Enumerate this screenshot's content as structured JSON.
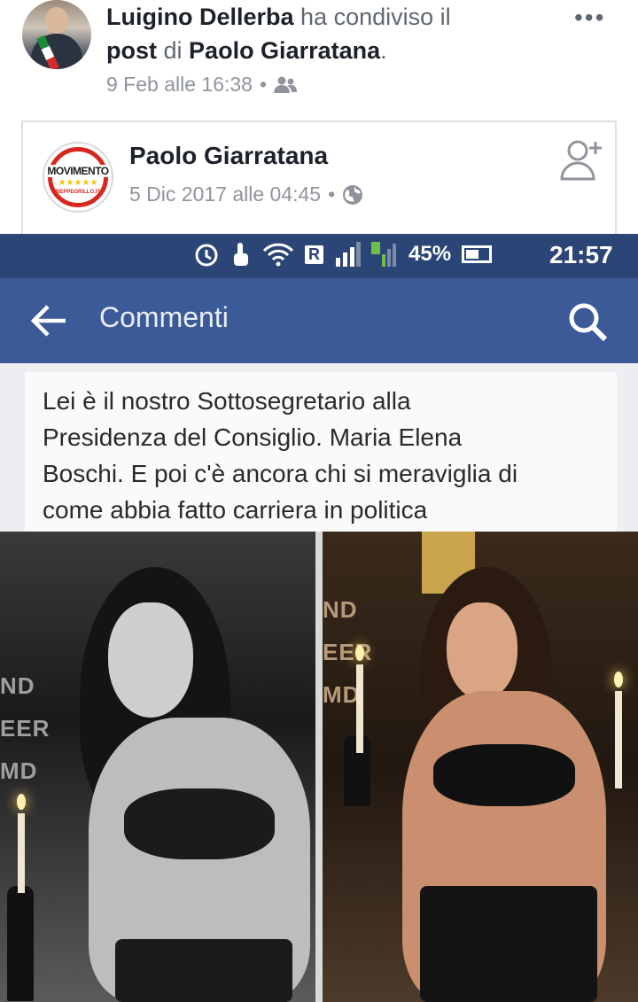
{
  "share": {
    "sharer_name": "Luigino Dellerba",
    "shared_phrase": "ha condiviso il",
    "post_word": "post",
    "of_word": "di",
    "author_name": "Paolo Giarratana",
    "period": ".",
    "timestamp": "9 Feb alle 16:38",
    "separator": "•",
    "audience_icon": "friends-icon",
    "more_label": "•••"
  },
  "original_post": {
    "page_name": "Paolo Giarratana",
    "timestamp": "5 Dic 2017 alle 04:45",
    "separator": "•",
    "audience_icon": "globe-icon",
    "logo": {
      "word": "MOVIMENTO",
      "stars": "★★★★★",
      "subtitle": "BEPPEGRILLO.IT",
      "ring_color": "#d6281f",
      "star_color": "#f3c10f"
    },
    "add_friend_icon": "add-friend-icon"
  },
  "screenshot": {
    "status_bar": {
      "r_badge": "R",
      "signal_1": "4",
      "signal_2": "2",
      "battery": "45%",
      "time": "21:57"
    },
    "app_bar": {
      "title": "Commenti",
      "back_icon": "back-arrow-icon",
      "search_icon": "search-icon",
      "color": "#3c5a98"
    },
    "comment": {
      "line1": "Lei è il nostro Sottosegretario alla",
      "line2": "Presidenza del Consiglio. Maria Elena",
      "line3": "Boschi. E poi c'è ancora chi si meraviglia di",
      "line4": "come abbia fatto carriera in politica"
    },
    "photos": {
      "left_sign": [
        "ND",
        "EER",
        "MD"
      ],
      "right_sign": [
        "ND",
        "EER",
        "MD"
      ]
    }
  }
}
